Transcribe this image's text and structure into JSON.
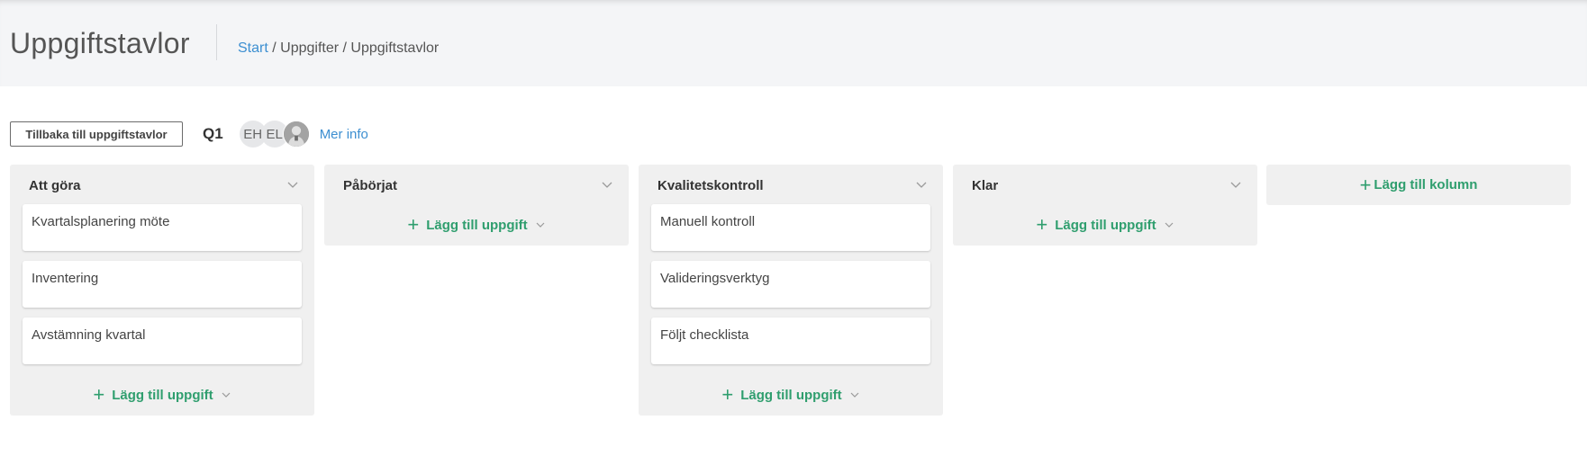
{
  "header": {
    "title": "Uppgiftstavlor",
    "breadcrumb": {
      "home": "Start",
      "sep1": " / ",
      "level1": "Uppgifter",
      "sep2": " / ",
      "current": "Uppgiftstavlor"
    }
  },
  "toolbar": {
    "back_label": "Tillbaka till uppgiftstavlor",
    "board_name": "Q1",
    "avatars": [
      {
        "initials": "EH"
      },
      {
        "initials": "EL"
      },
      {
        "initials": "",
        "icon": "user-photo"
      }
    ],
    "more_info": "Mer info"
  },
  "columns": [
    {
      "title": "Att göra",
      "cards": [
        "Kvartalsplanering möte",
        "Inventering",
        "Avstämning kvartal"
      ],
      "add_label": "Lägg till uppgift"
    },
    {
      "title": "Påbörjat",
      "cards": [],
      "add_label": "Lägg till uppgift"
    },
    {
      "title": "Kvalitetskontroll",
      "cards": [
        "Manuell kontroll",
        "Valideringsverktyg",
        "Följt checklista"
      ],
      "add_label": "Lägg till uppgift"
    },
    {
      "title": "Klar",
      "cards": [],
      "add_label": "Lägg till uppgift"
    }
  ],
  "add_column_label": "Lägg till kolumn",
  "colors": {
    "accent_green": "#2f9e6e",
    "link_blue": "#3d8fd1",
    "column_bg": "#f0f0f0",
    "header_bg": "#f4f5f7"
  }
}
